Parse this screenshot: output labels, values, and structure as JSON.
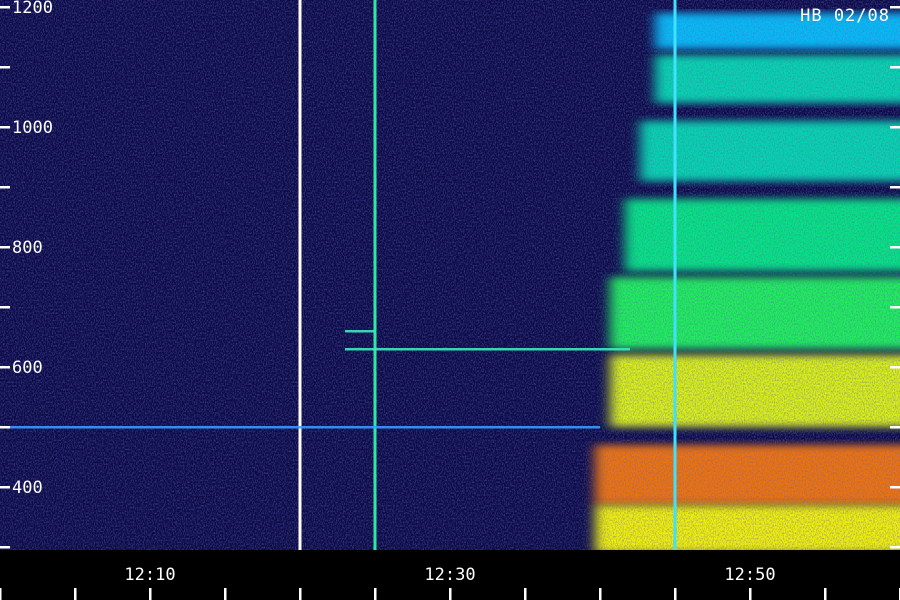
{
  "stamp": "HB 02/08",
  "chart_data": {
    "type": "heatmap",
    "title": "",
    "xlabel": "",
    "ylabel": "",
    "x_tick_labels": [
      "12:10",
      "12:30",
      "12:50"
    ],
    "x_minor_ticks": [
      "12:00",
      "12:05",
      "12:10",
      "12:15",
      "12:20",
      "12:25",
      "12:30",
      "12:35",
      "12:40",
      "12:45",
      "12:50",
      "12:55",
      "13:00"
    ],
    "y_major_ticks": [
      400,
      600,
      800,
      1000,
      1200
    ],
    "y_minor_ticks": [
      300,
      500,
      700,
      900,
      1100
    ],
    "ylim": [
      300,
      1200
    ],
    "xlim": [
      "12:00",
      "13:00"
    ],
    "colormap": [
      "#0a0a4a",
      "#2a20c8",
      "#00c8ff",
      "#00ff60",
      "#ffff00",
      "#ff2000"
    ],
    "series": [
      {
        "kind": "band",
        "center": 1160,
        "halfwidth": 30,
        "onset": "12:45",
        "level": 0.4
      },
      {
        "kind": "band",
        "center": 1080,
        "halfwidth": 40,
        "onset": "12:45",
        "level": 0.5
      },
      {
        "kind": "band",
        "center": 960,
        "halfwidth": 50,
        "onset": "12:44",
        "level": 0.5
      },
      {
        "kind": "band",
        "center": 820,
        "halfwidth": 60,
        "onset": "12:43",
        "level": 0.56
      },
      {
        "kind": "band",
        "center": 690,
        "halfwidth": 60,
        "onset": "12:42",
        "level": 0.62
      },
      {
        "kind": "band",
        "center": 560,
        "halfwidth": 60,
        "onset": "12:42",
        "level": 0.78
      },
      {
        "kind": "band",
        "center": 420,
        "halfwidth": 50,
        "onset": "12:41",
        "level": 0.92
      },
      {
        "kind": "band",
        "center": 330,
        "halfwidth": 40,
        "onset": "12:41",
        "level": 0.8
      }
    ],
    "vertical_lines": [
      {
        "time": "12:20",
        "color": "#ffffff"
      },
      {
        "time": "12:25",
        "color": "#30e8a0"
      },
      {
        "time": "12:45",
        "color": "#40e0ff"
      }
    ],
    "horizontal_streaks": [
      {
        "freq": 500,
        "from": "12:00",
        "to": "12:40",
        "color": "#3a9aff"
      },
      {
        "freq": 630,
        "from": "12:23",
        "to": "12:42",
        "color": "#40e8c0"
      },
      {
        "freq": 660,
        "from": "12:23",
        "to": "12:25",
        "color": "#40e8c0"
      }
    ]
  }
}
